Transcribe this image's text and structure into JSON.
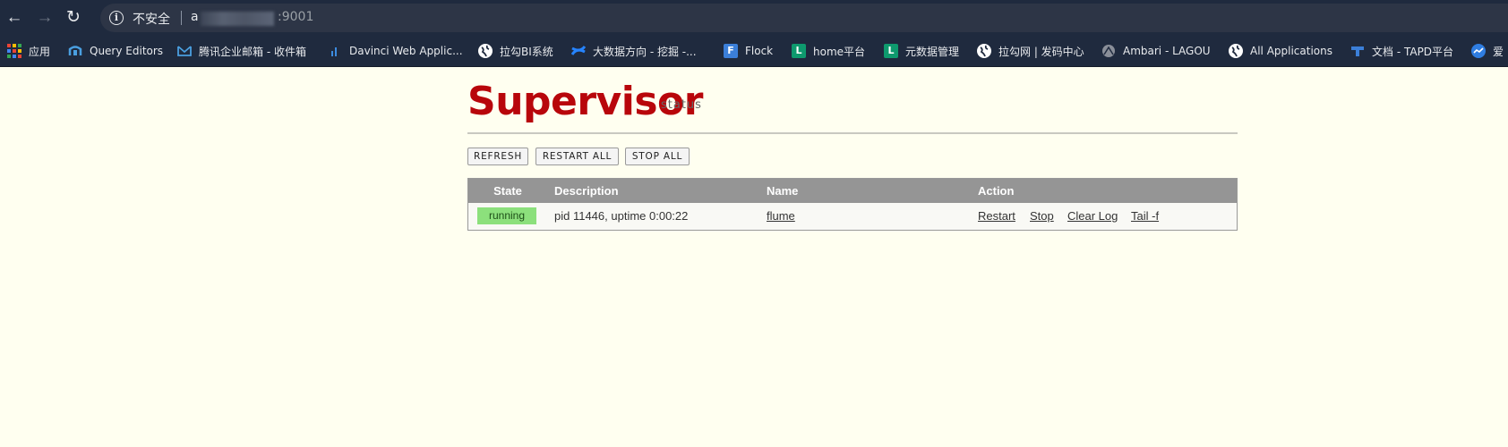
{
  "browser": {
    "security_label": "不安全",
    "url_prefix": "a",
    "url_suffix": ":9001",
    "bookmarks": [
      {
        "label": "应用",
        "icon": "apps-grid-icon"
      },
      {
        "label": "Query Editors",
        "icon": "query-editors-icon"
      },
      {
        "label": "腾讯企业邮箱 - 收件箱",
        "icon": "tencent-mail-icon"
      },
      {
        "label": "Davinci Web Applic...",
        "icon": "davinci-chart-icon"
      },
      {
        "label": "拉勾BI系统",
        "icon": "globe-icon"
      },
      {
        "label": "大数据方向 - 挖掘 -...",
        "icon": "confluence-icon"
      },
      {
        "label": "Flock",
        "icon": "flock-icon"
      },
      {
        "label": "home平台",
        "icon": "l-platform-icon"
      },
      {
        "label": "元数据管理",
        "icon": "l-platform-icon"
      },
      {
        "label": "拉勾网 | 发码中心",
        "icon": "globe-icon"
      },
      {
        "label": "Ambari - LAGOU",
        "icon": "ambari-icon"
      },
      {
        "label": "All Applications",
        "icon": "globe-icon"
      },
      {
        "label": "文档 - TAPD平台",
        "icon": "tapd-icon"
      },
      {
        "label": "爱",
        "icon": "aixin-icon"
      }
    ]
  },
  "page": {
    "logo_title": "Supervisor",
    "logo_subtitle": "status",
    "buttons": {
      "refresh": "REFRESH",
      "restart_all": "RESTART ALL",
      "stop_all": "STOP ALL"
    },
    "table": {
      "headers": {
        "state": "State",
        "description": "Description",
        "name": "Name",
        "action": "Action"
      },
      "rows": [
        {
          "state": "running",
          "description": "pid 11446, uptime 0:00:22",
          "name": "flume",
          "actions": [
            "Restart",
            "Stop",
            "Clear Log",
            "Tail -f"
          ]
        }
      ]
    }
  },
  "colors": {
    "browser_chrome": "#1f2a3e",
    "page_background": "#fffff0",
    "logo_red": "#b8060b",
    "table_header": "#959595",
    "running_badge": "#8ce07c"
  }
}
